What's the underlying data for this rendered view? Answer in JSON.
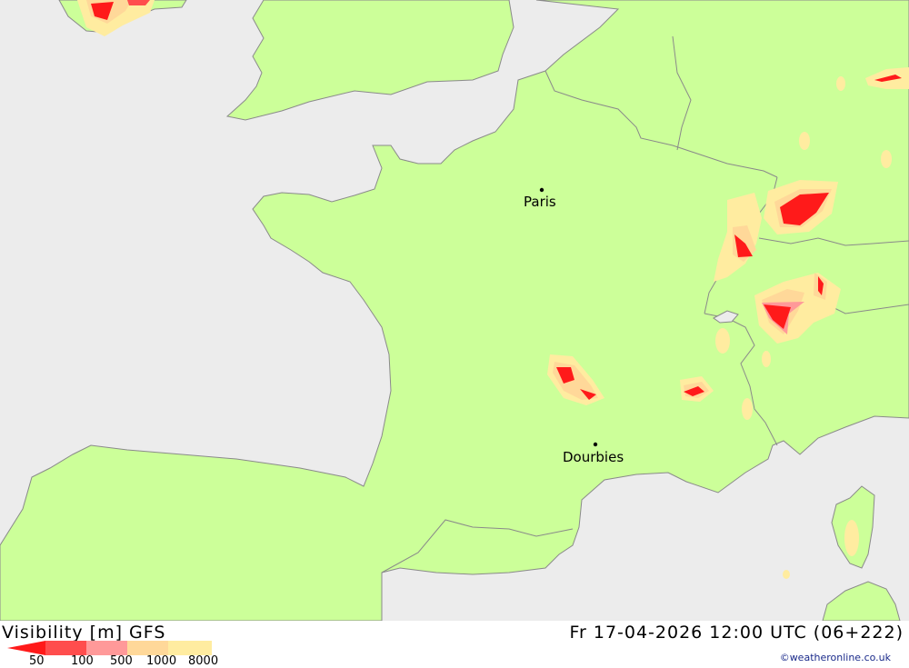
{
  "map": {
    "cities": [
      {
        "name": "Paris"
      },
      {
        "name": "Dourbies"
      }
    ],
    "colors": {
      "sea": "#ececec",
      "land": "#ccff99",
      "coast": "#8a8a8a",
      "border": "#8a8a8a",
      "vis_50": "#ff1a1a",
      "vis_100": "#ff4d4d",
      "vis_500": "#ff9999",
      "vis_1000": "#ffd899",
      "vis_8000": "#ffeca0"
    }
  },
  "footer": {
    "title": "Visibility [m] GFS",
    "datetime": "Fr 17-04-2026 12:00 UTC (06+222)",
    "credit": "©weatheronline.co.uk",
    "legend": [
      "50",
      "100",
      "500",
      "1000",
      "8000"
    ]
  }
}
